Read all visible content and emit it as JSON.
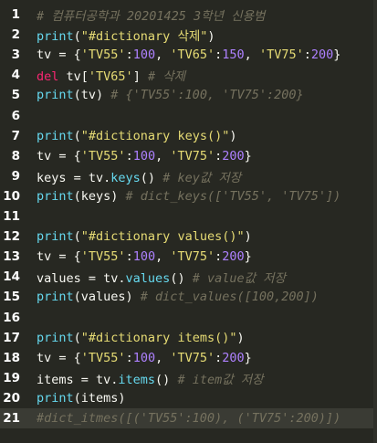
{
  "editor": {
    "current_line": 21,
    "lines": [
      {
        "n": "1",
        "t": [
          [
            "c",
            "# 컴퓨터공학과 20201425 3학년 신용범"
          ]
        ]
      },
      {
        "n": "2",
        "t": [
          [
            "f",
            "print"
          ],
          [
            "v",
            "("
          ],
          [
            "s",
            "\"#dictionary 삭제\""
          ],
          [
            "v",
            ")"
          ]
        ]
      },
      {
        "n": "3",
        "t": [
          [
            "v",
            "tv = {"
          ],
          [
            "s",
            "'TV55'"
          ],
          [
            "v",
            ":"
          ],
          [
            "n",
            "100"
          ],
          [
            "v",
            ", "
          ],
          [
            "s",
            "'TV65'"
          ],
          [
            "v",
            ":"
          ],
          [
            "n",
            "150"
          ],
          [
            "v",
            ", "
          ],
          [
            "s",
            "'TV75'"
          ],
          [
            "v",
            ":"
          ],
          [
            "n",
            "200"
          ],
          [
            "v",
            "}"
          ]
        ]
      },
      {
        "n": "4",
        "t": [
          [
            "k",
            "del"
          ],
          [
            "v",
            " tv["
          ],
          [
            "s",
            "'TV65'"
          ],
          [
            "v",
            "] "
          ],
          [
            "c",
            "# 삭제"
          ]
        ]
      },
      {
        "n": "5",
        "t": [
          [
            "f",
            "print"
          ],
          [
            "v",
            "(tv) "
          ],
          [
            "c",
            "# {'TV55':100, 'TV75':200}"
          ]
        ]
      },
      {
        "n": "6",
        "t": []
      },
      {
        "n": "7",
        "t": [
          [
            "f",
            "print"
          ],
          [
            "v",
            "("
          ],
          [
            "s",
            "\"#dictionary keys()\""
          ],
          [
            "v",
            ")"
          ]
        ]
      },
      {
        "n": "8",
        "t": [
          [
            "v",
            "tv = {"
          ],
          [
            "s",
            "'TV55'"
          ],
          [
            "v",
            ":"
          ],
          [
            "n",
            "100"
          ],
          [
            "v",
            ", "
          ],
          [
            "s",
            "'TV75'"
          ],
          [
            "v",
            ":"
          ],
          [
            "n",
            "200"
          ],
          [
            "v",
            "}"
          ]
        ]
      },
      {
        "n": "9",
        "t": [
          [
            "v",
            "keys = tv."
          ],
          [
            "f",
            "keys"
          ],
          [
            "v",
            "() "
          ],
          [
            "c",
            "# key값 저장"
          ]
        ]
      },
      {
        "n": "10",
        "t": [
          [
            "f",
            "print"
          ],
          [
            "v",
            "(keys) "
          ],
          [
            "c",
            "# dict_keys(['TV55', 'TV75'])"
          ]
        ]
      },
      {
        "n": "11",
        "t": []
      },
      {
        "n": "12",
        "t": [
          [
            "f",
            "print"
          ],
          [
            "v",
            "("
          ],
          [
            "s",
            "\"#dictionary values()\""
          ],
          [
            "v",
            ")"
          ]
        ]
      },
      {
        "n": "13",
        "t": [
          [
            "v",
            "tv = {"
          ],
          [
            "s",
            "'TV55'"
          ],
          [
            "v",
            ":"
          ],
          [
            "n",
            "100"
          ],
          [
            "v",
            ", "
          ],
          [
            "s",
            "'TV75'"
          ],
          [
            "v",
            ":"
          ],
          [
            "n",
            "200"
          ],
          [
            "v",
            "}"
          ]
        ]
      },
      {
        "n": "14",
        "t": [
          [
            "v",
            "values = tv."
          ],
          [
            "f",
            "values"
          ],
          [
            "v",
            "() "
          ],
          [
            "c",
            "# value값 저장"
          ]
        ]
      },
      {
        "n": "15",
        "t": [
          [
            "f",
            "print"
          ],
          [
            "v",
            "(values) "
          ],
          [
            "c",
            "# dict_values([100,200])"
          ]
        ]
      },
      {
        "n": "16",
        "t": []
      },
      {
        "n": "17",
        "t": [
          [
            "f",
            "print"
          ],
          [
            "v",
            "("
          ],
          [
            "s",
            "\"#dictionary items()\""
          ],
          [
            "v",
            ")"
          ]
        ]
      },
      {
        "n": "18",
        "t": [
          [
            "v",
            "tv = {"
          ],
          [
            "s",
            "'TV55'"
          ],
          [
            "v",
            ":"
          ],
          [
            "n",
            "100"
          ],
          [
            "v",
            ", "
          ],
          [
            "s",
            "'TV75'"
          ],
          [
            "v",
            ":"
          ],
          [
            "n",
            "200"
          ],
          [
            "v",
            "}"
          ]
        ]
      },
      {
        "n": "19",
        "t": [
          [
            "v",
            "items = tv."
          ],
          [
            "f",
            "items"
          ],
          [
            "v",
            "() "
          ],
          [
            "c",
            "# item값 저장"
          ]
        ]
      },
      {
        "n": "20",
        "t": [
          [
            "f",
            "print"
          ],
          [
            "v",
            "(items)"
          ]
        ]
      },
      {
        "n": "21",
        "t": [
          [
            "c",
            "#dict_itmes([('TV55':100), ('TV75':200)])"
          ]
        ]
      }
    ]
  }
}
